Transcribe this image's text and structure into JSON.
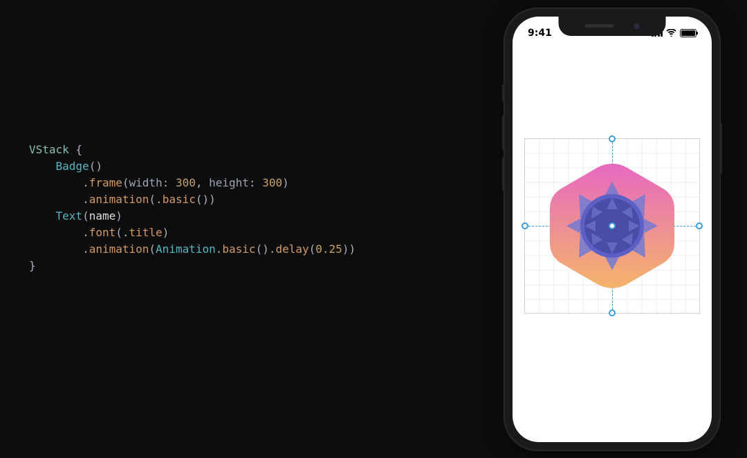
{
  "code": {
    "tokens": {
      "vstack": "VStack",
      "lbrace": " {",
      "badge": "Badge",
      "parens": "()",
      "dot": ".",
      "frame": "frame",
      "lparen": "(",
      "width_lbl": "width",
      "colon_sp": ": ",
      "width_val": "300",
      "comma_sp": ", ",
      "height_lbl": "height",
      "height_val": "300",
      "rparen": ")",
      "animation": "animation",
      "basic": "basic",
      "text": "Text",
      "name_var": "name",
      "font": "font",
      "title": "title",
      "animation_type": "Animation",
      "delay": "delay",
      "delay_val": "0.25",
      "rbrace": "}"
    }
  },
  "phone": {
    "status": {
      "time": "9:41"
    }
  },
  "badge": {
    "gradient_top": "#e668c1",
    "gradient_bottom": "#f5b46a",
    "inner_purple": "#5d5fc5",
    "inner_dark": "#4a4ca8",
    "petal": "#7577d0"
  },
  "guides": {
    "color": "#3a9fd8"
  }
}
